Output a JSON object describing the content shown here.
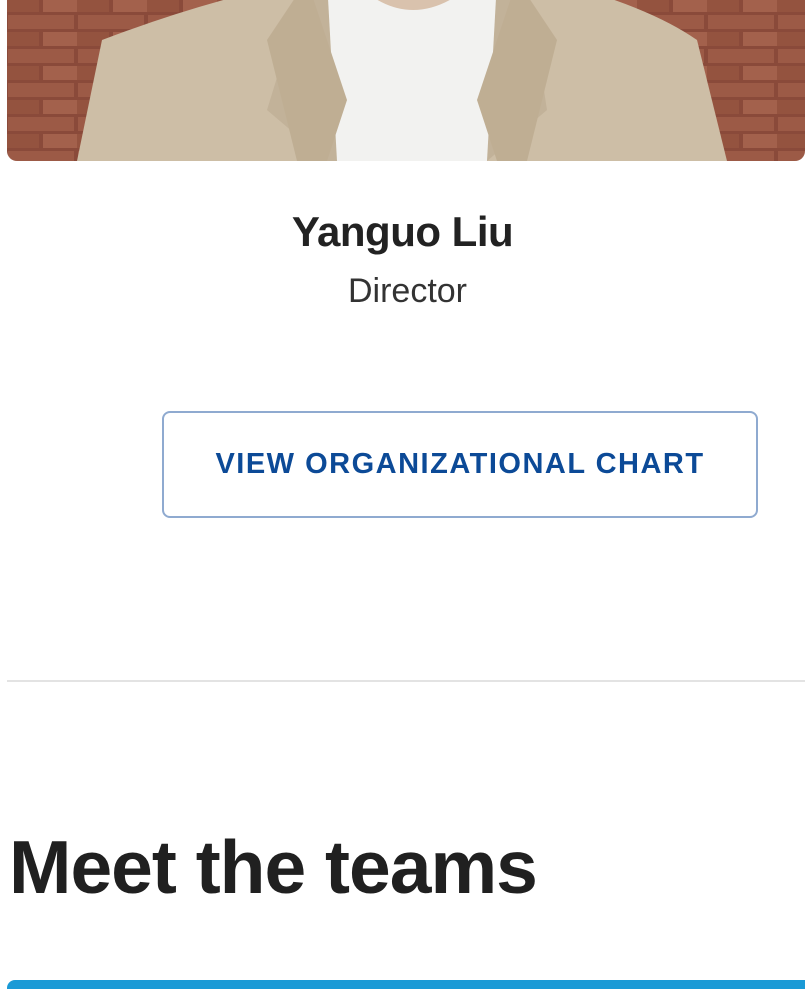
{
  "profile": {
    "name": "Yanguo Liu",
    "title": "Director",
    "photo_alt": "profile-photo"
  },
  "actions": {
    "org_chart_label": "VIEW ORGANIZATIONAL CHART"
  },
  "teams": {
    "heading": "Meet the teams"
  },
  "colors": {
    "accent_blue": "#0c4a97",
    "button_border": "#8faad0",
    "teams_bar": "#1a9ad6",
    "divider": "#e3e3e3"
  }
}
